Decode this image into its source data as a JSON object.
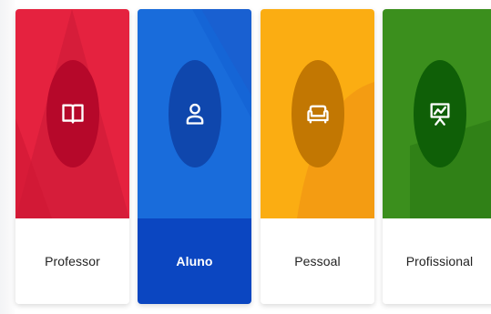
{
  "cards": [
    {
      "id": "professor",
      "label": "Professor",
      "icon": "book-icon",
      "hero_color": "#e5223f",
      "circle_color": "#b6082a",
      "footer_color": "#ffffff",
      "selected": false
    },
    {
      "id": "aluno",
      "label": "Aluno",
      "icon": "user-icon",
      "hero_color": "#1565d6",
      "circle_color": "#0f47ad",
      "footer_color": "#0b46c1",
      "selected": true
    },
    {
      "id": "pessoal",
      "label": "Pessoal",
      "icon": "sofa-icon",
      "hero_color": "#fbad12",
      "circle_color": "#c27702",
      "footer_color": "#ffffff",
      "selected": false
    },
    {
      "id": "profissional",
      "label": "Profissional",
      "icon": "presentation-chart-icon",
      "hero_color": "#3b8f1d",
      "circle_color": "#0f5f07",
      "footer_color": "#ffffff",
      "selected": false
    }
  ]
}
